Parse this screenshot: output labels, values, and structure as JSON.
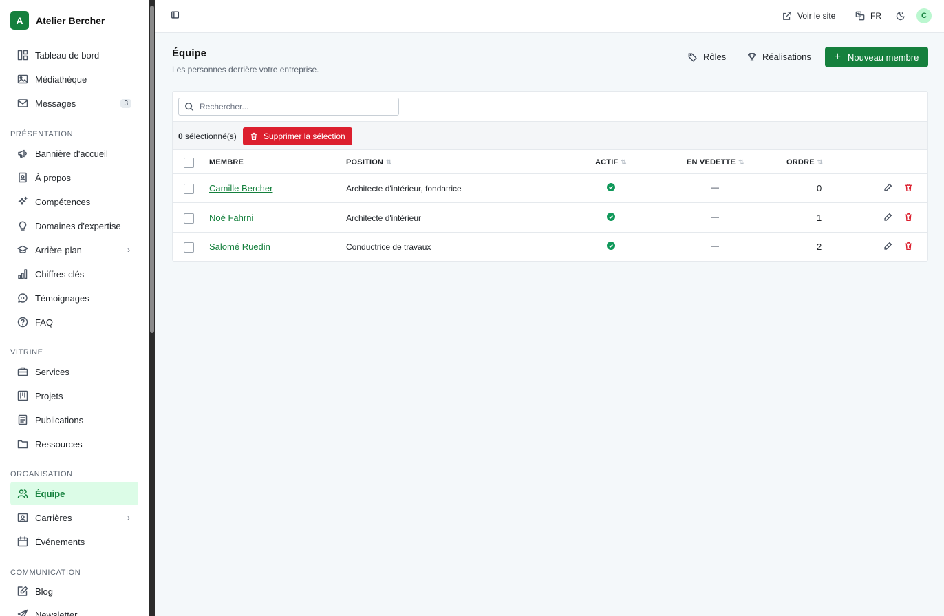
{
  "brand": {
    "initial": "A",
    "name": "Atelier Bercher"
  },
  "sidebar": {
    "top_items": [
      {
        "label": "Tableau de bord",
        "icon": "dashboard-icon"
      },
      {
        "label": "Médiathèque",
        "icon": "image-icon"
      },
      {
        "label": "Messages",
        "icon": "mail-icon",
        "badge": "3"
      }
    ],
    "sections": [
      {
        "title": "PRÉSENTATION",
        "items": [
          {
            "label": "Bannière d'accueil",
            "icon": "megaphone-icon"
          },
          {
            "label": "À propos",
            "icon": "contact-card-icon"
          },
          {
            "label": "Compétences",
            "icon": "sparkles-icon"
          },
          {
            "label": "Domaines d'expertise",
            "icon": "lightbulb-icon"
          },
          {
            "label": "Arrière-plan",
            "icon": "graduation-cap-icon",
            "chevron": true
          },
          {
            "label": "Chiffres clés",
            "icon": "bar-chart-icon"
          },
          {
            "label": "Témoignages",
            "icon": "quote-bubble-icon"
          },
          {
            "label": "FAQ",
            "icon": "help-circle-icon"
          }
        ]
      },
      {
        "title": "VITRINE",
        "items": [
          {
            "label": "Services",
            "icon": "briefcase-icon"
          },
          {
            "label": "Projets",
            "icon": "kanban-icon"
          },
          {
            "label": "Publications",
            "icon": "document-icon"
          },
          {
            "label": "Ressources",
            "icon": "folder-icon"
          }
        ]
      },
      {
        "title": "ORGANISATION",
        "items": [
          {
            "label": "Équipe",
            "icon": "users-icon",
            "active": true
          },
          {
            "label": "Carrières",
            "icon": "id-badge-icon",
            "chevron": true
          },
          {
            "label": "Événements",
            "icon": "calendar-icon"
          }
        ]
      },
      {
        "title": "COMMUNICATION",
        "items": [
          {
            "label": "Blog",
            "icon": "edit-icon"
          },
          {
            "label": "Newsletter",
            "icon": "send-icon"
          }
        ]
      }
    ]
  },
  "header": {
    "view_site": "Voir le site",
    "language": "FR",
    "avatar_initial": "C"
  },
  "page": {
    "title": "Équipe",
    "subtitle": "Les personnes derrière votre entreprise.",
    "roles_label": "Rôles",
    "achievements_label": "Réalisations",
    "new_member_label": "Nouveau membre"
  },
  "table": {
    "search_placeholder": "Rechercher...",
    "selected_count": "0",
    "selected_suffix": "sélectionné(s)",
    "delete_selection": "Supprimer la sélection",
    "columns": {
      "member": "MEMBRE",
      "position": "POSITION",
      "active": "ACTIF",
      "featured": "EN VEDETTE",
      "order": "ORDRE"
    },
    "rows": [
      {
        "name": "Camille Bercher",
        "position": "Architecte d'intérieur, fondatrice",
        "active": true,
        "featured": "—",
        "order": "0"
      },
      {
        "name": "Noé Fahrni",
        "position": "Architecte d'intérieur",
        "active": true,
        "featured": "—",
        "order": "1"
      },
      {
        "name": "Salomé Ruedin",
        "position": "Conductrice de travaux",
        "active": true,
        "featured": "—",
        "order": "2"
      }
    ]
  },
  "colors": {
    "accent": "#15803d",
    "danger": "#dc1f2e",
    "active_bg": "#dcfce7",
    "success": "#10985a"
  }
}
